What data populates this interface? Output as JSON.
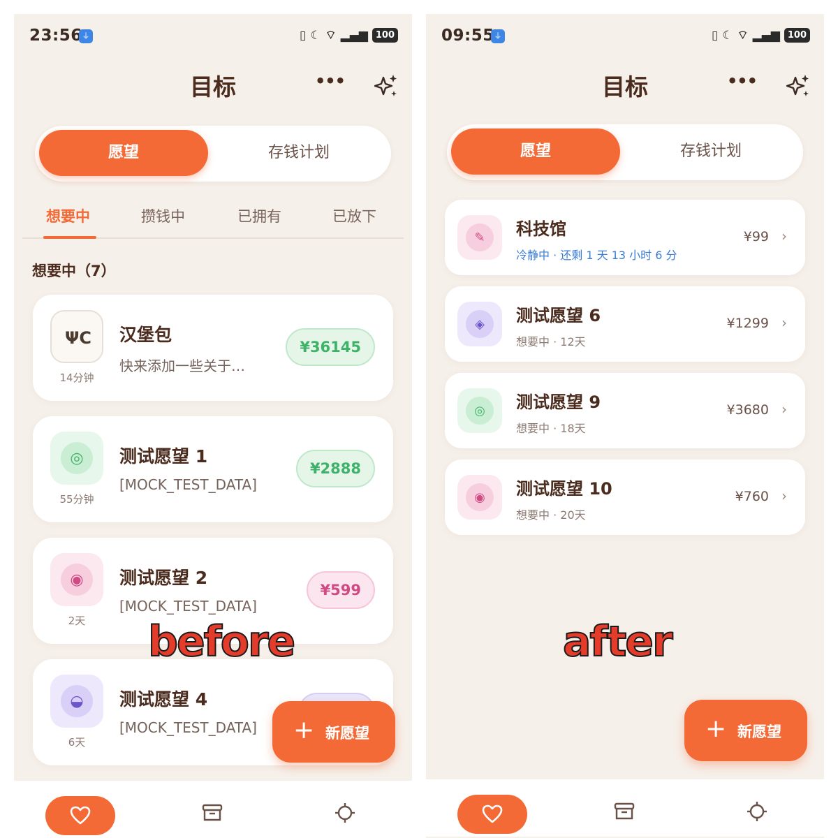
{
  "before": {
    "status": {
      "time": "23:56",
      "battery": "100"
    },
    "header": {
      "title": "目标",
      "more": "•••"
    },
    "segment": {
      "active": "愿望",
      "inactive": "存钱计划"
    },
    "subtabs": [
      "想要中",
      "攒钱中",
      "已拥有",
      "已放下"
    ],
    "section_title": "想要中（7）",
    "cards": [
      {
        "name": "汉堡包",
        "desc": "快来添加一些关于…",
        "age": "14分钟",
        "price": "¥36145",
        "icon": "utensils-icon",
        "icon_glyph": "ΨС",
        "theme": "neutral"
      },
      {
        "name": "测试愿望 1",
        "desc": "[MOCK_TEST_DATA]",
        "age": "55分钟",
        "price": "¥2888",
        "icon": "leaf-icon",
        "icon_glyph": "◎",
        "theme": "green"
      },
      {
        "name": "测试愿望 2",
        "desc": "[MOCK_TEST_DATA]",
        "age": "2天",
        "price": "¥599",
        "icon": "swirl-icon",
        "icon_glyph": "◉",
        "theme": "pink"
      },
      {
        "name": "测试愿望 4",
        "desc": "[MOCK_TEST_DATA]",
        "age": "6天",
        "price": "",
        "icon": "drop-icon",
        "icon_glyph": "◒",
        "theme": "purple"
      }
    ],
    "fab": {
      "plus": "+",
      "label": "新愿望"
    },
    "overlay_label": "before"
  },
  "after": {
    "status": {
      "time": "09:55",
      "battery": "100"
    },
    "header": {
      "title": "目标",
      "more": "•••"
    },
    "segment": {
      "active": "愿望",
      "inactive": "存钱计划"
    },
    "cards": [
      {
        "name": "科技馆",
        "sub": "冷静中 · 还剩 1 天 13 小时 6 分",
        "price": "¥99",
        "icon": "microphone-icon",
        "icon_glyph": "✎",
        "theme": "pink"
      },
      {
        "name": "测试愿望 6",
        "sub": "想要中 · 12天",
        "price": "¥1299",
        "icon": "target-icon",
        "icon_glyph": "◈",
        "theme": "purple"
      },
      {
        "name": "测试愿望 9",
        "sub": "想要中 · 18天",
        "price": "¥3680",
        "icon": "leaf-icon",
        "icon_glyph": "◎",
        "theme": "green"
      },
      {
        "name": "测试愿望 10",
        "sub": "想要中 · 20天",
        "price": "¥760",
        "icon": "swirl-icon",
        "icon_glyph": "◉",
        "theme": "pink"
      }
    ],
    "chevron": "›",
    "fab": {
      "plus": "+",
      "label": "新愿望"
    },
    "overlay_label": "after"
  },
  "colors": {
    "accent": "#f46a36",
    "background": "#f6f0ea",
    "green_bg": "#e5f6e9",
    "green_fg": "#3fb26a",
    "green_border": "#bfe8cb",
    "pink_bg": "#fbe5ee",
    "pink_fg": "#d04a83",
    "pink_border": "#f5c6d8",
    "purple_bg": "#ebe6fb",
    "purple_fg": "#6c55c8",
    "purple_border": "#d6cdf5"
  }
}
